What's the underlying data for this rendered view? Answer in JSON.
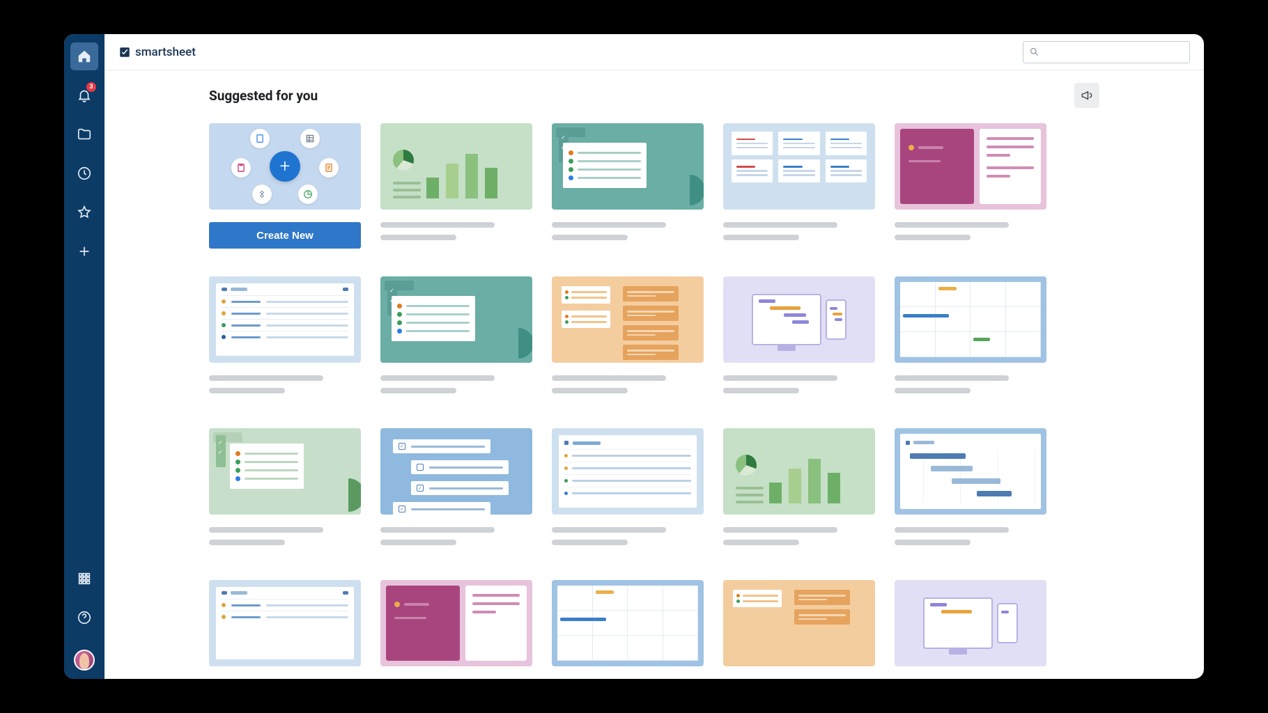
{
  "brand": {
    "name": "smartsheet"
  },
  "sidebar": {
    "notification_count": "3",
    "icons": {
      "home": "home-icon",
      "bell": "bell-icon",
      "folder": "folder-icon",
      "clock": "clock-icon",
      "star": "star-icon",
      "plus": "plus-icon",
      "apps": "apps-icon",
      "help": "help-icon",
      "avatar": "user-avatar"
    }
  },
  "search": {
    "placeholder": ""
  },
  "section": {
    "title": "Suggested for you",
    "announce_icon": "megaphone-icon"
  },
  "create_new": {
    "label": "Create New"
  },
  "colors": {
    "sidebar": "#0c3b66",
    "primary_button": "#2f77c9",
    "badge": "#e63946"
  }
}
